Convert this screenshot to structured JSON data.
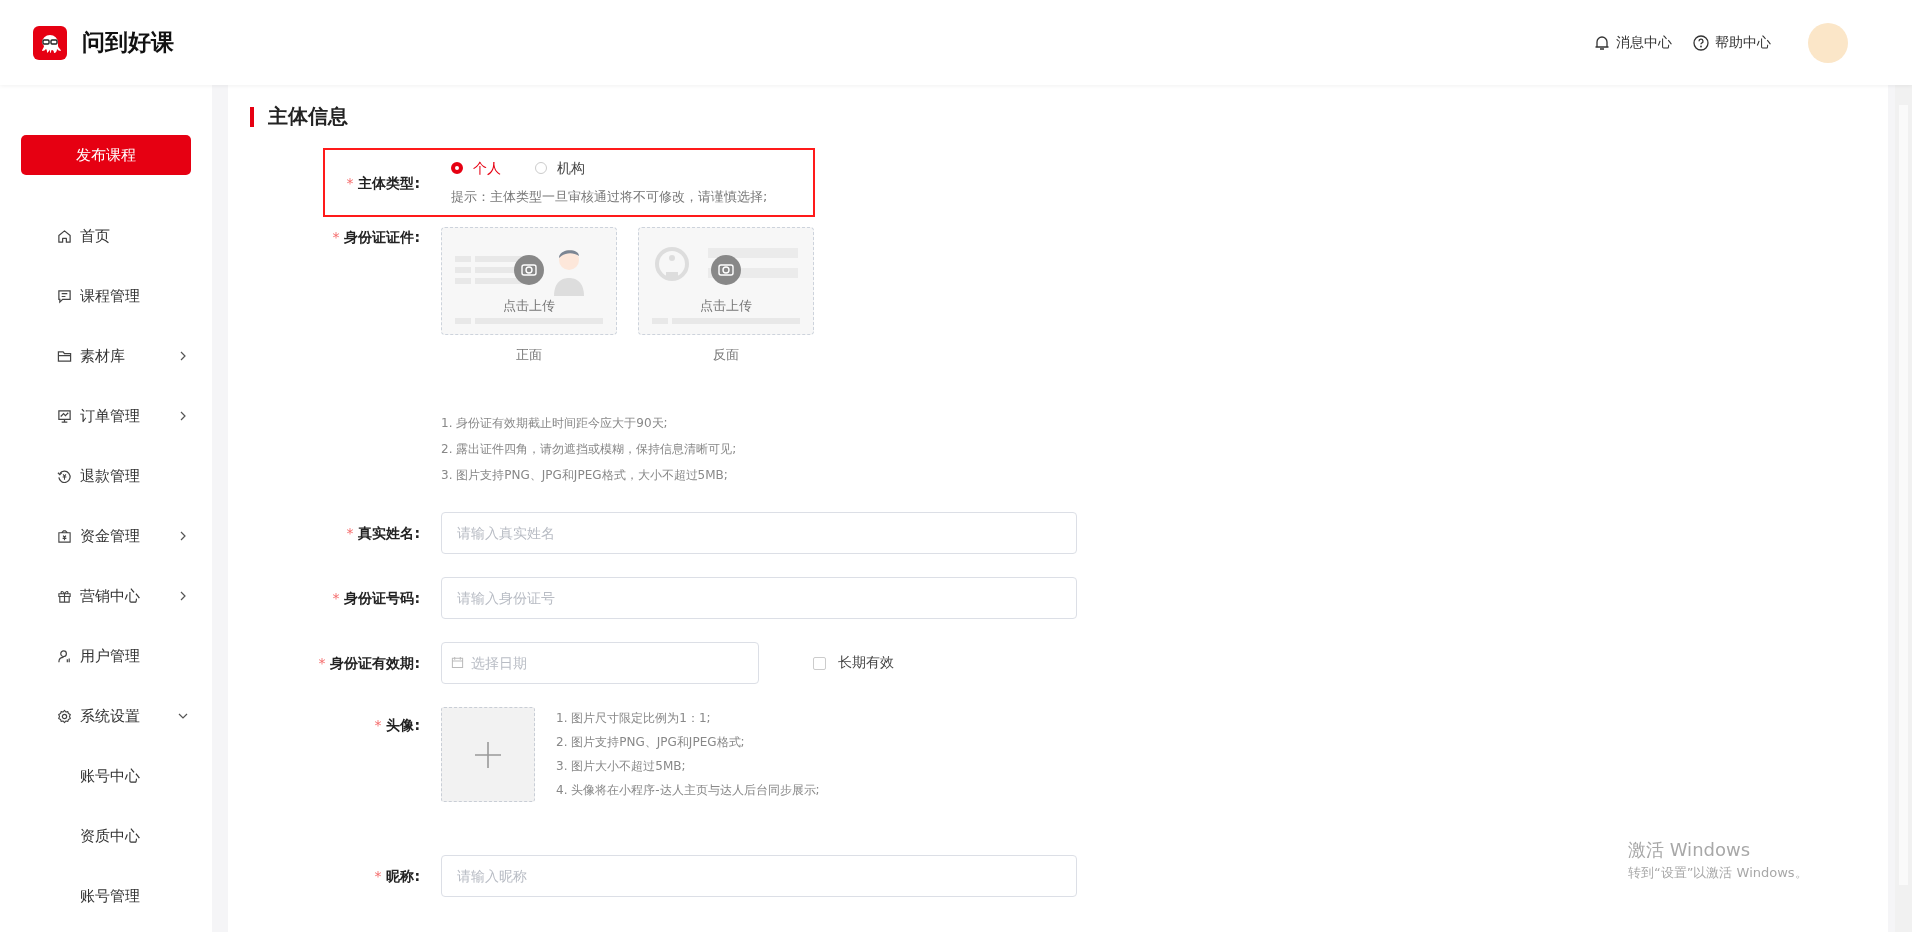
{
  "header": {
    "logo_text": "问到好课",
    "actions": [
      {
        "kind": "bell",
        "label": "消息中心"
      },
      {
        "kind": "help",
        "label": "帮助中心"
      }
    ]
  },
  "sidebar": {
    "publish_button": "发布课程",
    "items": [
      {
        "label": "首页",
        "expandable": false
      },
      {
        "label": "课程管理",
        "expandable": false
      },
      {
        "label": "素材库",
        "expandable": true,
        "expanded": false
      },
      {
        "label": "订单管理",
        "expandable": true,
        "expanded": false
      },
      {
        "label": "退款管理",
        "expandable": false
      },
      {
        "label": "资金管理",
        "expandable": true,
        "expanded": false
      },
      {
        "label": "营销中心",
        "expandable": true,
        "expanded": false
      },
      {
        "label": "用户管理",
        "expandable": false
      },
      {
        "label": "系统设置",
        "expandable": true,
        "expanded": true,
        "children": [
          {
            "label": "账号中心"
          },
          {
            "label": "资质中心"
          },
          {
            "label": "账号管理"
          }
        ]
      }
    ]
  },
  "form": {
    "title": "主体信息",
    "fields": [
      {
        "kind": "radio",
        "label": "主体类型:",
        "required_mark": "*",
        "highlighted": true,
        "options": [
          {
            "label": "个人",
            "selected": true
          },
          {
            "label": "机构",
            "selected": false
          }
        ],
        "hint": "提示：主体类型一旦审核通过将不可修改，请谨慎选择;"
      },
      {
        "kind": "id_upload",
        "label": "身份证证件:",
        "required_mark": "*",
        "slots": [
          {
            "upload_text": "点击上传",
            "caption": "正面"
          },
          {
            "upload_text": "点击上传",
            "caption": "反面"
          }
        ],
        "notes": [
          "1. 身份证有效期截止时间距今应大于90天;",
          "2. 露出证件四角，请勿遮挡或模糊，保持信息清晰可见;",
          "3. 图片支持PNG、JPG和JPEG格式，大小不超过5MB;"
        ]
      },
      {
        "kind": "text",
        "label": "真实姓名:",
        "required_mark": "*",
        "placeholder": "请输入真实姓名"
      },
      {
        "kind": "text",
        "label": "身份证号码:",
        "required_mark": "*",
        "placeholder": "请输入身份证号"
      },
      {
        "kind": "date",
        "label": "身份证有效期:",
        "required_mark": "*",
        "placeholder": "选择日期",
        "checkbox": {
          "label": "长期有效",
          "checked": false
        }
      },
      {
        "kind": "avatar_upload",
        "label": "头像:",
        "required_mark": "*",
        "notes": [
          "1. 图片尺寸限定比例为1：1;",
          "2. 图片支持PNG、JPG和JPEG格式;",
          "3. 图片大小不超过5MB;",
          "4. 头像将在小程序-达人主页与达人后台同步展示;"
        ]
      },
      {
        "kind": "text",
        "label": "昵称:",
        "required_mark": "*",
        "placeholder": "请输入昵称"
      }
    ]
  },
  "os_notice": {
    "title": "激活 Windows",
    "subtitle": "转到“设置”以激活 Windows。"
  }
}
